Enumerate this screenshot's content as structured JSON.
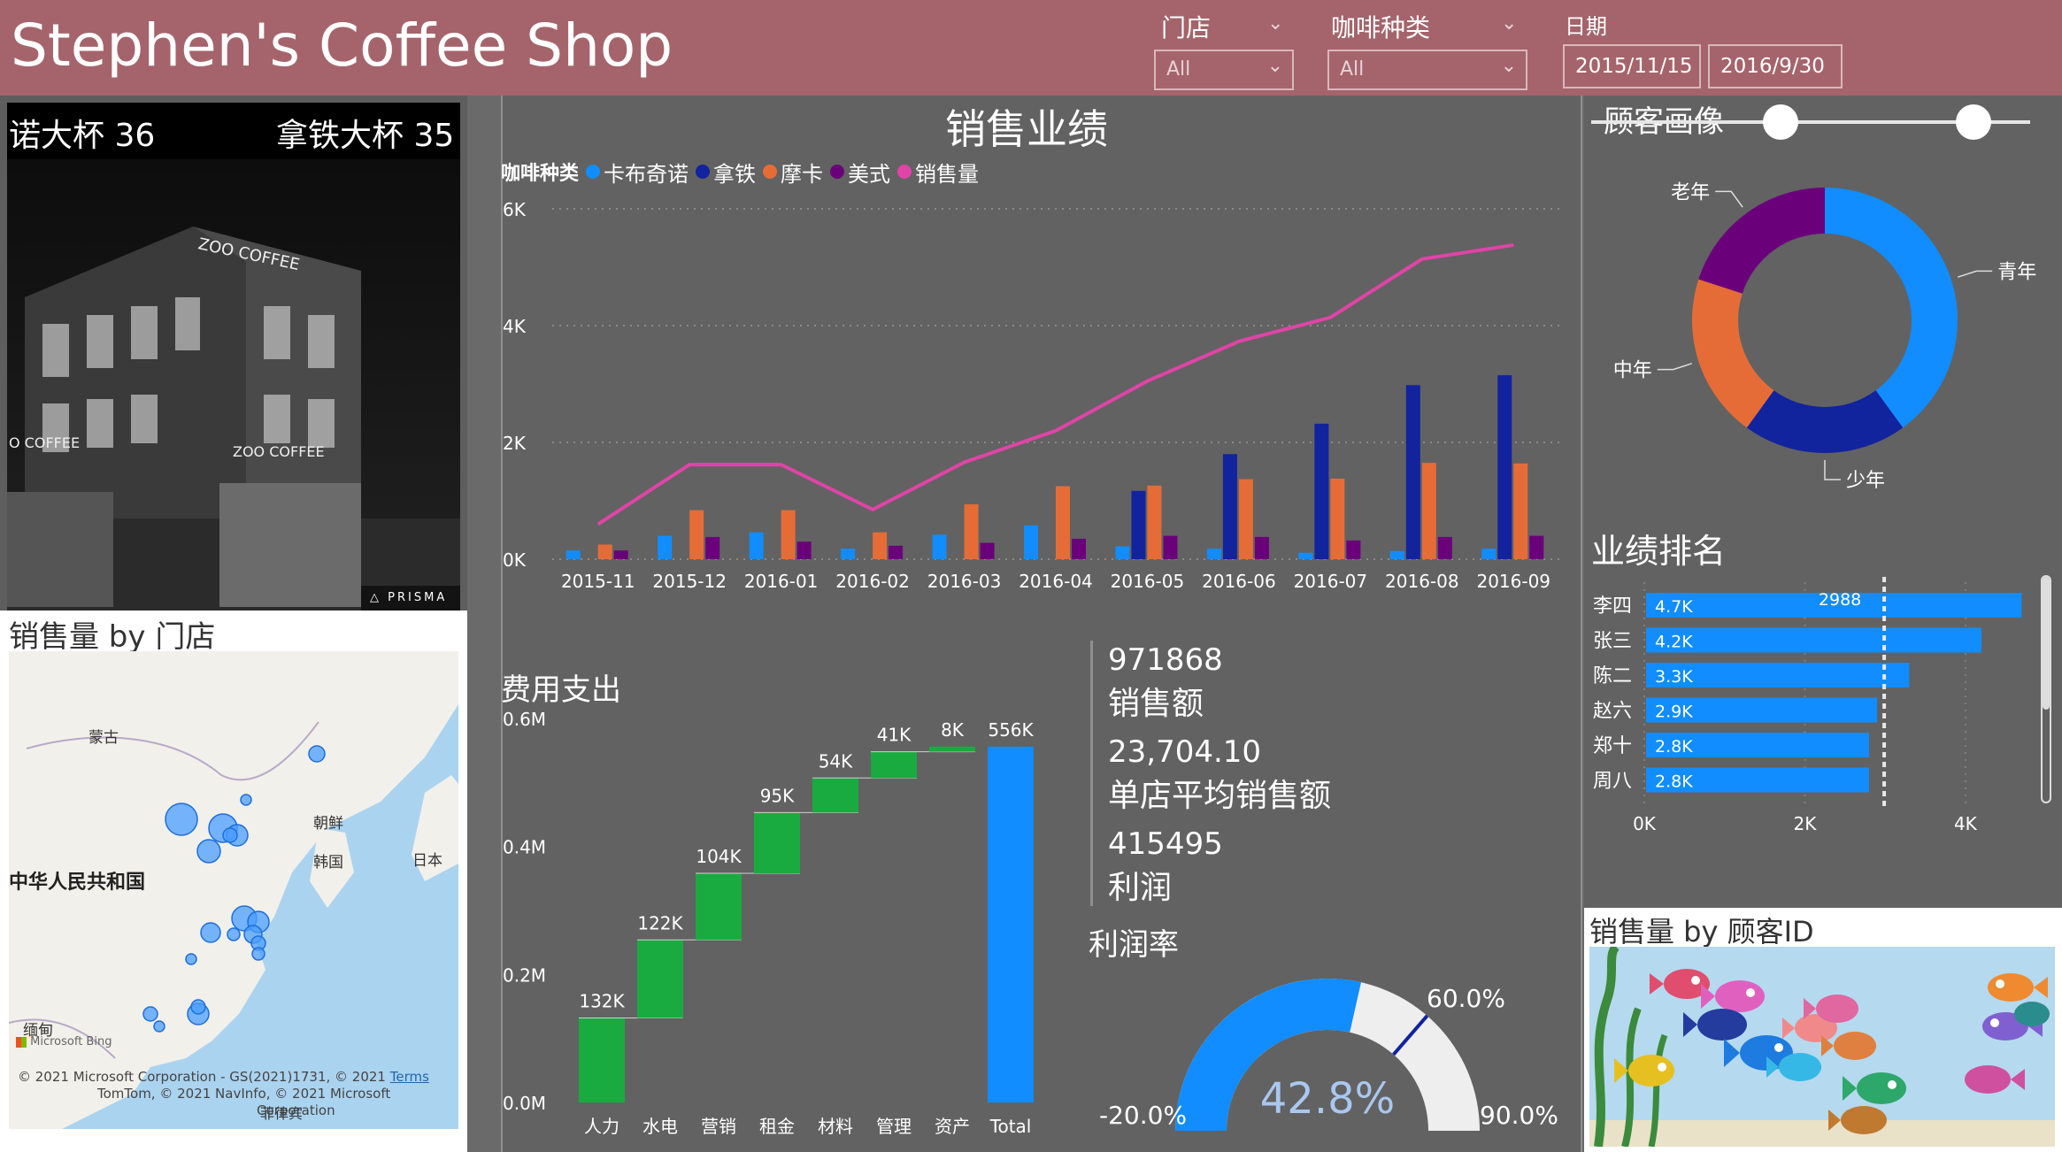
{
  "app_title": "Stephen's Coffee Shop",
  "filters": {
    "store_label": "门店",
    "store_value": "All",
    "coffee_label": "咖啡种类",
    "coffee_value": "All",
    "date_label": "日期",
    "date_start": "2015/11/15",
    "date_end": "2016/9/30"
  },
  "ticker": {
    "left_text": "诺大杯  36",
    "right_text": "拿铁大杯  35"
  },
  "photo": {
    "watermark": "PRISMA",
    "sign_text_1": "ZOO COFFEE",
    "sign_text_2": "ZOO COFFEE",
    "sign_text_3": "O COFFEE"
  },
  "map_section": {
    "title": "销售量 by 门店",
    "labels": {
      "mongolia": "蒙古",
      "china": "中华人民共和国",
      "nkorea": "朝鲜",
      "skorea": "韩国",
      "japan": "日本",
      "myanmar": "缅甸",
      "philippines": "菲律宾"
    },
    "bing": "Microsoft Bing",
    "copyright_1": "© 2021 Microsoft Corporation - GS(2021)1731, © 2021",
    "terms": "Terms",
    "copyright_2": "TomTom, © 2021 NavInfo, © 2021 Microsoft",
    "copyright_3": "Corporation"
  },
  "sales_chart": {
    "title": "销售业绩",
    "legend_title": "咖啡种类",
    "colors": {
      "卡布奇诺": "#118dff",
      "拿铁": "#12239e",
      "摩卡": "#e66c37",
      "美式": "#6b007b",
      "销售量": "#e044a7"
    },
    "chart_data": {
      "type": "bar",
      "categories": [
        "2015-11",
        "2015-12",
        "2016-01",
        "2016-02",
        "2016-03",
        "2016-04",
        "2016-05",
        "2016-06",
        "2016-07",
        "2016-08",
        "2016-09"
      ],
      "ylim": [
        0,
        6000
      ],
      "yticks": [
        "0K",
        "2K",
        "4K",
        "6K"
      ],
      "series": [
        {
          "name": "卡布奇诺",
          "type": "bar",
          "values": [
            150,
            400,
            460,
            180,
            420,
            580,
            220,
            180,
            110,
            140,
            180
          ]
        },
        {
          "name": "拿铁",
          "type": "bar",
          "values": [
            0,
            0,
            0,
            0,
            0,
            0,
            1170,
            1800,
            2320,
            2980,
            3150
          ]
        },
        {
          "name": "摩卡",
          "type": "bar",
          "values": [
            250,
            840,
            840,
            460,
            940,
            1250,
            1260,
            1370,
            1380,
            1650,
            1640
          ]
        },
        {
          "name": "美式",
          "type": "bar",
          "values": [
            150,
            380,
            300,
            230,
            280,
            350,
            400,
            380,
            320,
            380,
            400
          ]
        },
        {
          "name": "销售量",
          "type": "line",
          "values": [
            600,
            1620,
            1620,
            850,
            1660,
            2200,
            3050,
            3730,
            4140,
            5140,
            5380
          ]
        }
      ]
    }
  },
  "expense_chart": {
    "title": "费用支出",
    "chart_data": {
      "type": "waterfall",
      "categories": [
        "人力",
        "水电",
        "营销",
        "租金",
        "材料",
        "管理",
        "资产",
        "Total"
      ],
      "values": [
        132,
        122,
        104,
        95,
        54,
        41,
        8,
        556
      ],
      "value_labels": [
        "132K",
        "122K",
        "104K",
        "95K",
        "54K",
        "41K",
        "8K",
        "556K"
      ],
      "ylim": [
        0,
        0.6
      ],
      "yticks": [
        "0.0M",
        "0.2M",
        "0.4M",
        "0.6M"
      ]
    }
  },
  "kpis": [
    {
      "value": "971868",
      "label": "销售额"
    },
    {
      "value": "23,704.10",
      "label": "单店平均销售额"
    },
    {
      "value": "415495",
      "label": "利润"
    }
  ],
  "gauge": {
    "title": "利润率",
    "value_label": "42.8%",
    "min_label": "-20.0%",
    "max_label": "90.0%",
    "target_label": "60.0%",
    "value": 42.8,
    "min": -20,
    "max": 90,
    "target": 60
  },
  "customer_portrait": {
    "title": "顾客画像",
    "chart_data": {
      "type": "pie",
      "labels": [
        "青年",
        "少年",
        "中年",
        "老年"
      ],
      "values": [
        40,
        20,
        20,
        20
      ],
      "colors": [
        "#118dff",
        "#12239e",
        "#e66c37",
        "#6b007b"
      ]
    }
  },
  "ranking": {
    "title": "业绩排名",
    "reference_label": "2988",
    "chart_data": {
      "type": "bar",
      "categories": [
        "李四",
        "张三",
        "陈二",
        "赵六",
        "郑十",
        "周八"
      ],
      "values": [
        4700,
        4200,
        3300,
        2900,
        2800,
        2800
      ],
      "value_labels": [
        "4.7K",
        "4.2K",
        "3.3K",
        "2.9K",
        "2.8K",
        "2.8K"
      ],
      "reference": 2988,
      "xlim": [
        0,
        4850
      ],
      "xticks": [
        "0K",
        "2K",
        "4K"
      ]
    }
  },
  "customer_id_section": {
    "title": "销售量 by 顾客ID"
  }
}
